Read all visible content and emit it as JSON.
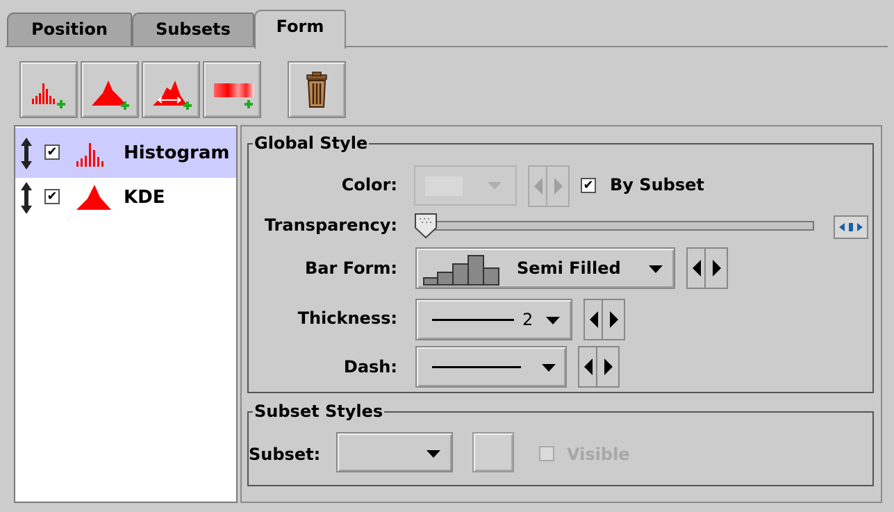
{
  "tabs": [
    {
      "label": "Position",
      "active": false
    },
    {
      "label": "Subsets",
      "active": false
    },
    {
      "label": "Form",
      "active": true
    }
  ],
  "toolbar": {
    "buttons": [
      {
        "icon": "add-histogram-icon"
      },
      {
        "icon": "add-kde-icon"
      },
      {
        "icon": "add-knn-icon"
      },
      {
        "icon": "add-densogram-icon"
      }
    ],
    "delete_icon": "trash-icon"
  },
  "layers": [
    {
      "label": "Histogram",
      "checked": true,
      "selected": true,
      "icon": "histogram-icon"
    },
    {
      "label": "KDE",
      "checked": true,
      "selected": false,
      "icon": "kde-icon"
    }
  ],
  "global_style": {
    "title": "Global Style",
    "color": {
      "label": "Color:",
      "by_subset_label": "By Subset",
      "by_subset_checked": true
    },
    "transparency": {
      "label": "Transparency:",
      "value": 0
    },
    "bar_form": {
      "label": "Bar Form:",
      "value": "Semi Filled"
    },
    "thickness": {
      "label": "Thickness:",
      "value": "2"
    },
    "dash": {
      "label": "Dash:"
    }
  },
  "subset_styles": {
    "title": "Subset Styles",
    "subset_label": "Subset:",
    "visible_label": "Visible",
    "visible_checked": false
  },
  "colors": {
    "selection": "#ccccff",
    "plot_red": "#ff0000",
    "panel_bg": "#cccccc",
    "add_green": "#22aa22"
  }
}
